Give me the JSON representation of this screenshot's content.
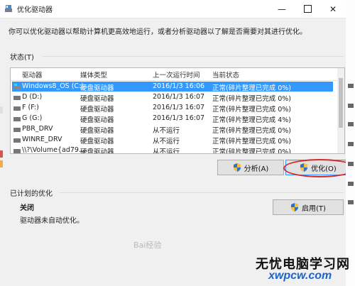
{
  "window": {
    "title": "优化驱动器",
    "min_icon": "minimize-icon",
    "max_icon": "maximize-icon",
    "close_icon": "close-icon"
  },
  "intro": "你可以优化驱动器以帮助计算机更高效地运行，或者分析驱动器以了解是否需要对其进行优化。",
  "status_label": "状态(T)",
  "columns": [
    "驱动器",
    "媒体类型",
    "上一次运行时间",
    "当前状态"
  ],
  "drives": [
    {
      "name": "Windows8_OS (C:)",
      "media": "硬盘驱动器",
      "last_run": "2016/1/3 16:06",
      "status": "正常(碎片整理已完成 0%)",
      "selected": true
    },
    {
      "name": "D (D:)",
      "media": "硬盘驱动器",
      "last_run": "2016/1/3 16:07",
      "status": "正常(碎片整理已完成 0%)",
      "selected": false
    },
    {
      "name": "F (F:)",
      "media": "硬盘驱动器",
      "last_run": "2016/1/3 16:07",
      "status": "正常(碎片整理已完成 0%)",
      "selected": false
    },
    {
      "name": "G (G:)",
      "media": "硬盘驱动器",
      "last_run": "2016/1/3 16:07",
      "status": "正常(碎片整理已完成 4%)",
      "selected": false
    },
    {
      "name": "PBR_DRV",
      "media": "硬盘驱动器",
      "last_run": "从不运行",
      "status": "正常(碎片整理已完成 0%)",
      "selected": false
    },
    {
      "name": "WINRE_DRV",
      "media": "硬盘驱动器",
      "last_run": "从不运行",
      "status": "正常(碎片整理已完成 0%)",
      "selected": false
    },
    {
      "name": "\\\\?\\Volume{ad79...",
      "media": "硬盘驱动器",
      "last_run": "从不运行",
      "status": "正常(碎片整理已完成 0%)",
      "selected": false
    }
  ],
  "buttons": {
    "analyze": "分析(A)",
    "optimize": "优化(O)",
    "enable": "启用(T)"
  },
  "scheduled": {
    "section_label": "已计划的优化",
    "state": "关闭",
    "desc": "驱动器未自动优化。"
  },
  "colors": {
    "selection": "#3399ff",
    "highlight_ring": "#d62a2a",
    "watermark_blue": "#1e64c8"
  },
  "watermark": {
    "site_cn": "无忧电脑学习网",
    "site_url": "xwpcw.com",
    "baidu": "Bai经验"
  }
}
